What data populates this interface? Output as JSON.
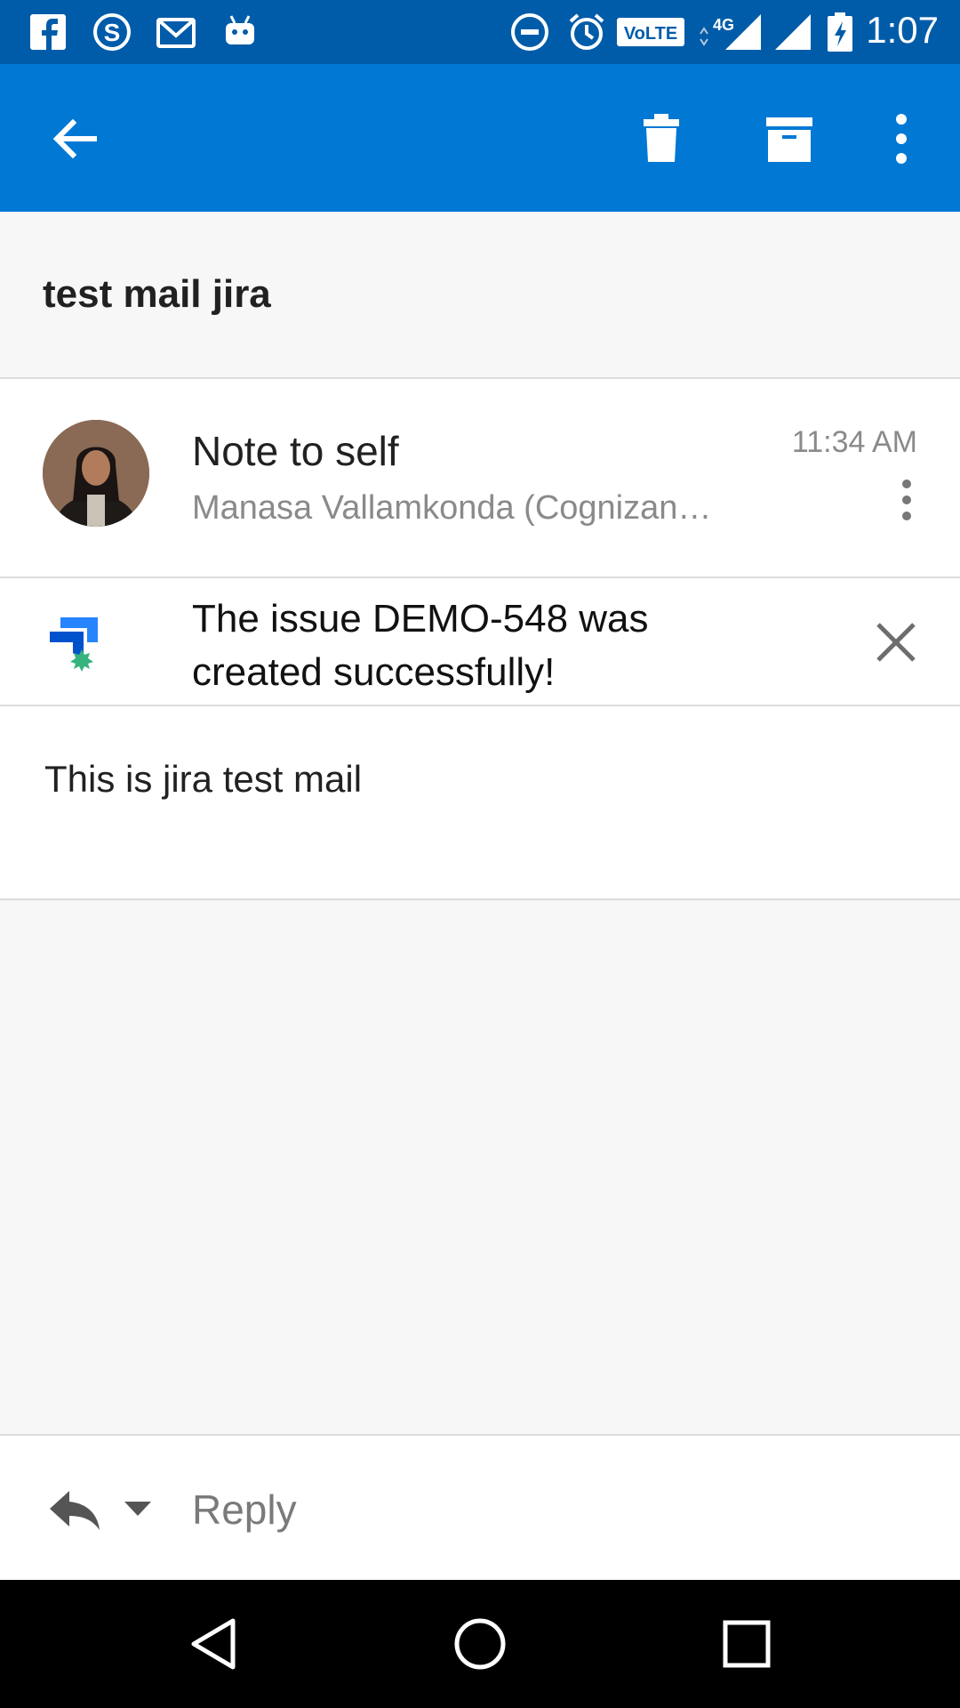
{
  "status_bar": {
    "time": "1:07",
    "icons": [
      "facebook-icon",
      "skype-icon",
      "gmail-icon",
      "android-debug-icon",
      "do-not-disturb-icon",
      "alarm-icon",
      "volte-icon",
      "signal-4g-icon",
      "signal-icon",
      "battery-charging-icon"
    ],
    "volte_label": "VoLTE",
    "network_label": "4G"
  },
  "app_bar": {
    "actions": [
      "back",
      "delete",
      "archive",
      "more"
    ]
  },
  "message": {
    "subject": "test mail jira",
    "sender_name": "Note to self",
    "sender_email": "Manasa Vallamkonda (Cognizan…",
    "time": "11:34 AM",
    "body": "This is jira test mail"
  },
  "banner": {
    "text": "The issue DEMO-548 was created successfully!"
  },
  "reply": {
    "label": "Reply"
  },
  "colors": {
    "status_bar": "#005ca9",
    "app_bar": "#0078d4",
    "jira_blue": "#2684ff",
    "jira_green": "#36b37e"
  }
}
